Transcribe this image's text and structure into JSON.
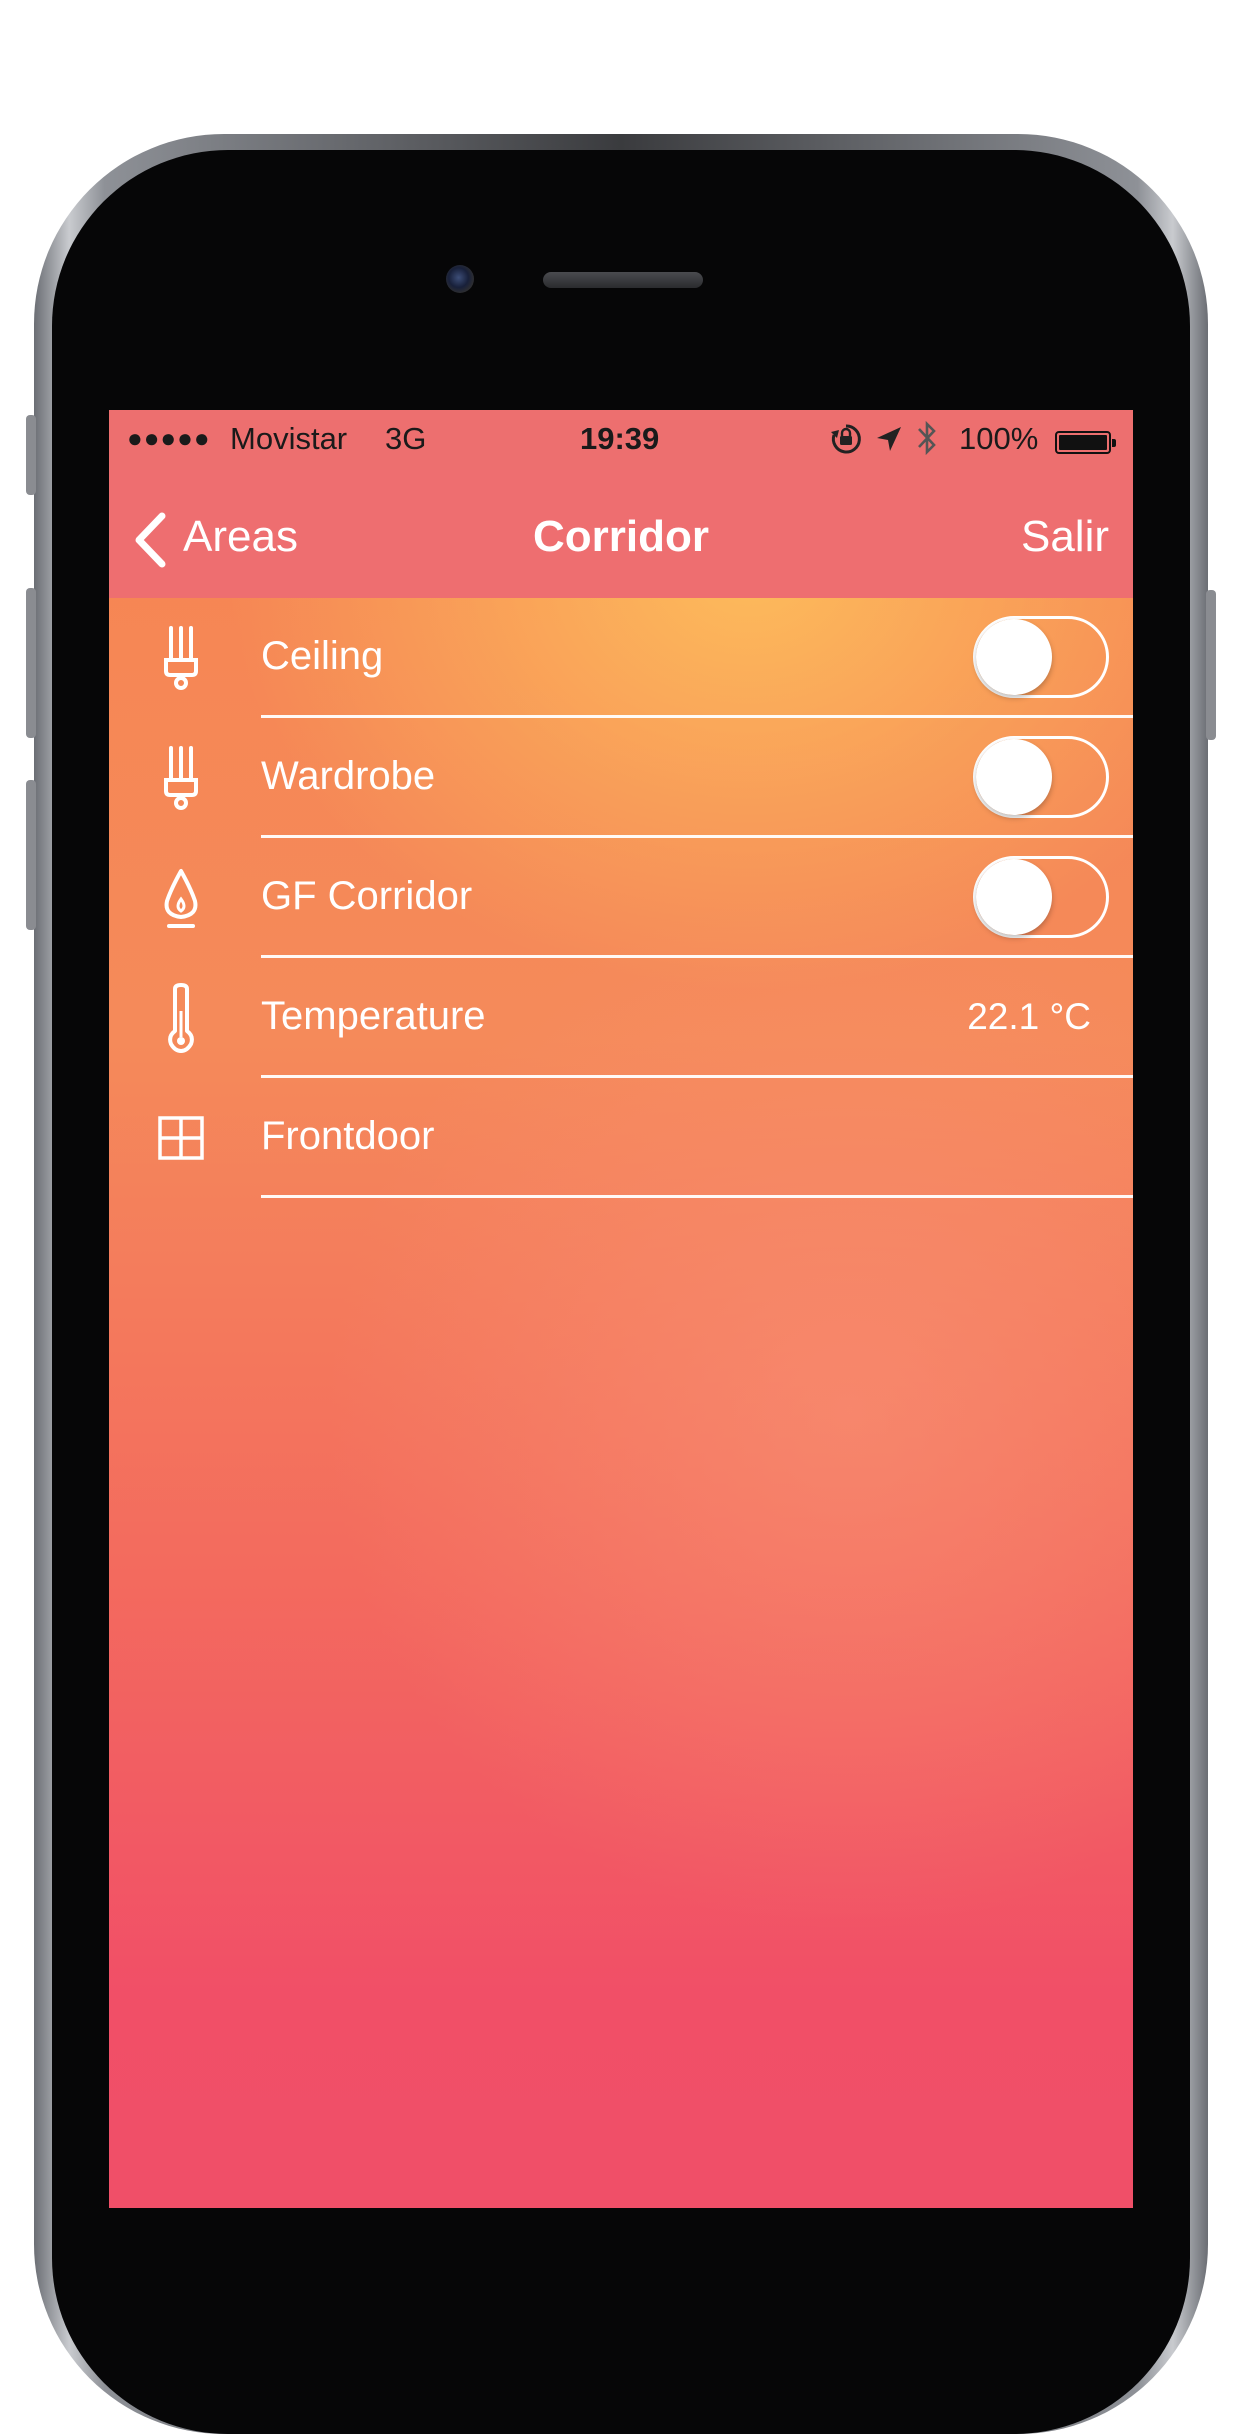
{
  "status_bar": {
    "signal": "●●●●●",
    "carrier": "Movistar",
    "network": "3G",
    "time": "19:39",
    "battery": "100%"
  },
  "nav": {
    "back_label": "Areas",
    "title": "Corridor",
    "exit_label": "Salir"
  },
  "rows": [
    {
      "label": "Ceiling",
      "icon": "bulb-icon",
      "toggle_on": false
    },
    {
      "label": "Wardrobe",
      "icon": "bulb-icon",
      "toggle_on": false
    },
    {
      "label": "GF Corridor",
      "icon": "flame-icon",
      "toggle_on": false
    },
    {
      "label": "Temperature",
      "icon": "thermometer-icon",
      "value": "22.1 °C"
    },
    {
      "label": "Frontdoor",
      "icon": "window-icon"
    }
  ],
  "colors": {
    "bar": "#ed6f6f",
    "gradient_top": "#f68552",
    "gradient_highlight": "#fdbe5c",
    "gradient_bottom": "#f04f68"
  }
}
